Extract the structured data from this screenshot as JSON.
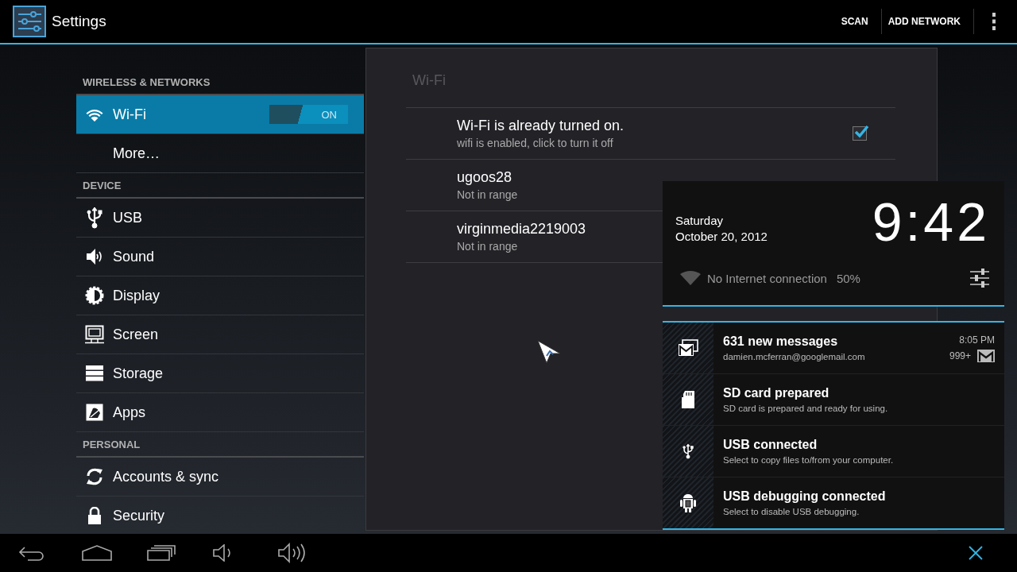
{
  "action_bar": {
    "title": "Settings",
    "actions": [
      "SCAN",
      "ADD NETWORK"
    ]
  },
  "sidebar": {
    "sections": [
      {
        "header": "WIRELESS & NETWORKS",
        "items": [
          {
            "label": "Wi-Fi",
            "selected": true,
            "toggle": {
              "on": true,
              "label": "ON"
            }
          },
          {
            "label": "More…",
            "selected": false
          }
        ]
      },
      {
        "header": "DEVICE",
        "items": [
          {
            "label": "USB",
            "selected": false
          },
          {
            "label": "Sound",
            "selected": false
          },
          {
            "label": "Display",
            "selected": false
          },
          {
            "label": "Screen",
            "selected": false
          },
          {
            "label": "Storage",
            "selected": false
          },
          {
            "label": "Apps",
            "selected": false
          }
        ]
      },
      {
        "header": "PERSONAL",
        "items": [
          {
            "label": "Accounts & sync",
            "selected": false
          },
          {
            "label": "Security",
            "selected": false
          }
        ]
      }
    ]
  },
  "main_panel": {
    "title": "Wi-Fi",
    "rows": [
      {
        "kind": "toggle",
        "title": "Wi-Fi is already turned on.",
        "subtitle": "wifi is enabled, click to turn it off",
        "checked": true
      },
      {
        "kind": "network",
        "title": "ugoos28",
        "subtitle": "Not in range"
      },
      {
        "kind": "network",
        "title": "virginmedia2219003",
        "subtitle": "Not in range"
      }
    ]
  },
  "notification_panel": {
    "day": "Saturday",
    "date": "October 20, 2012",
    "time": "9:42",
    "connection": "No Internet connection",
    "battery": "50%",
    "notifications": [
      {
        "kind": "mail",
        "title": "631 new messages",
        "text": "damien.mcferran@googlemail.com",
        "time": "8:05 PM",
        "count": "999+"
      },
      {
        "kind": "sd",
        "title": "SD card prepared",
        "text": "SD card is prepared and ready for using."
      },
      {
        "kind": "usb",
        "title": "USB connected",
        "text": "Select to copy files to/from your computer."
      },
      {
        "kind": "debug",
        "title": "USB debugging connected",
        "text": "Select to disable USB debugging."
      }
    ]
  }
}
